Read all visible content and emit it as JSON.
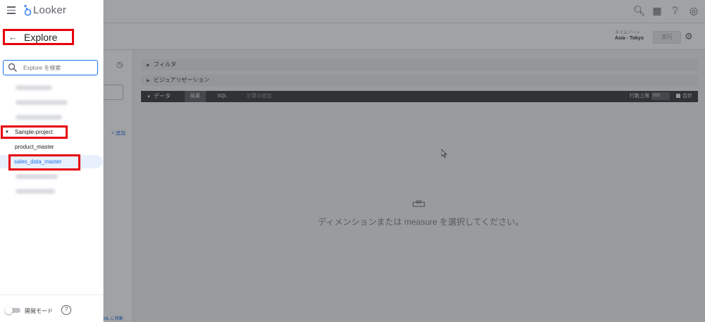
{
  "app": {
    "name": "Looker"
  },
  "drawer": {
    "title": "Explore",
    "search": {
      "placeholder": "Explore を検索"
    },
    "project": {
      "label": "Sample-project"
    },
    "models": [
      {
        "label": "product_master"
      },
      {
        "label": "sales_data_master",
        "selected": true
      }
    ],
    "footer": {
      "dev_mode_label": "開発モード",
      "dev_mode_on": false,
      "help_icon": "?"
    }
  },
  "topbar": {
    "icons": [
      "search-icon",
      "marketplace-icon",
      "help-icon",
      "account-icon"
    ]
  },
  "toolbar": {
    "timezone_label": "タイムゾーン",
    "timezone_value": "Asia - Tokyo",
    "run_label": "実行"
  },
  "field_panel": {
    "add_label": "追加",
    "footer_text": "ML に移動"
  },
  "sections": {
    "filter_label": "フィルタ",
    "viz_label": "ビジュアリゼーション",
    "data_label": "データ",
    "tabs": [
      "結果",
      "SQL",
      "計算の追加"
    ],
    "row_limit_label": "行数上限",
    "row_limit_value": "500",
    "totals_label": "合計"
  },
  "empty_state": {
    "message": "ディメンションまたは measure を選択してください。"
  },
  "colors": {
    "highlight": "#e8000b",
    "accent": "#1a73e8",
    "selected_bg": "#e8f0fe"
  }
}
